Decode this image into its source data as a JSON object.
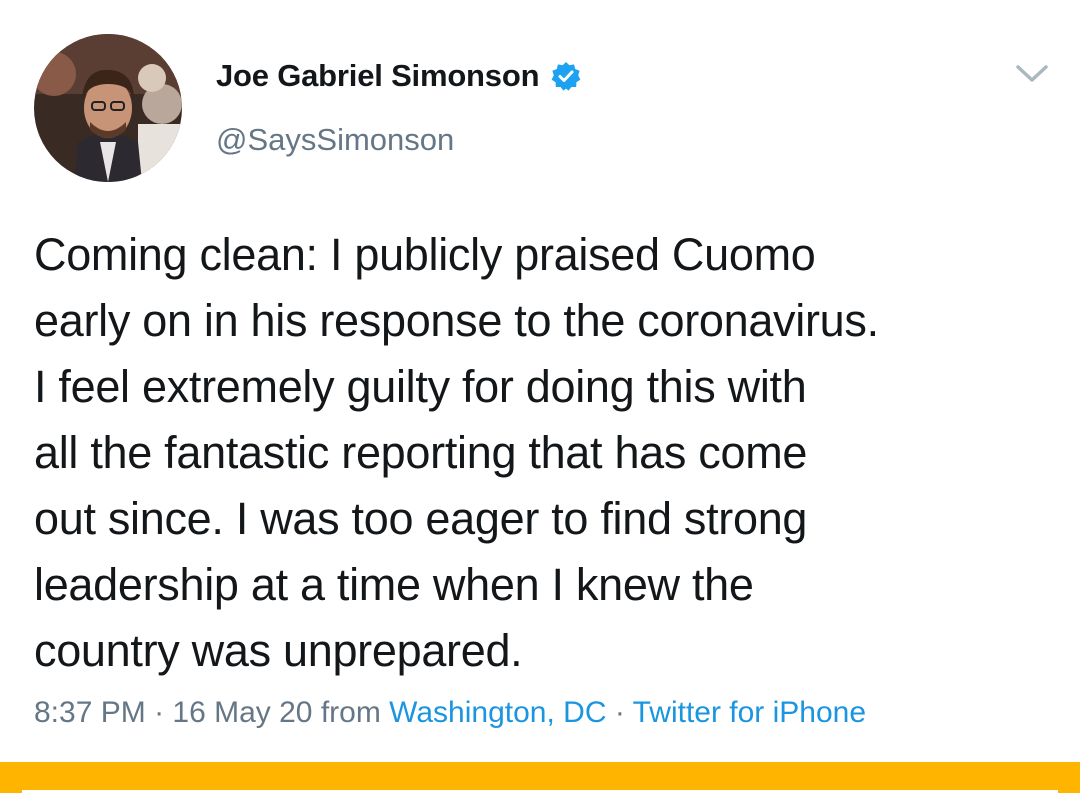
{
  "tweet": {
    "author": {
      "display_name": "Joe Gabriel Simonson",
      "handle": "@SaysSimonson",
      "verified": true
    },
    "text": "Coming clean: I publicly praised Cuomo\nearly on in his response to the coronavirus.\nI feel extremely guilty for doing this with\nall the fantastic reporting that has come\nout since. I was too eager to find strong\nleadership at a time when I knew the\ncountry was unprepared.",
    "meta": {
      "time": "8:37 PM",
      "sep1": " · ",
      "date": "16 May 20",
      "from_word": " from ",
      "location": "Washington, DC",
      "sep2": " · ",
      "client": "Twitter for iPhone"
    }
  },
  "icons": {
    "verified": "verified-badge-icon",
    "menu": "chevron-down-icon"
  },
  "colors": {
    "text_primary": "#14171a",
    "text_secondary": "#657786",
    "link": "#1b95e0",
    "verified_blue": "#1da1f2",
    "accent_bar": "#ffb400"
  }
}
